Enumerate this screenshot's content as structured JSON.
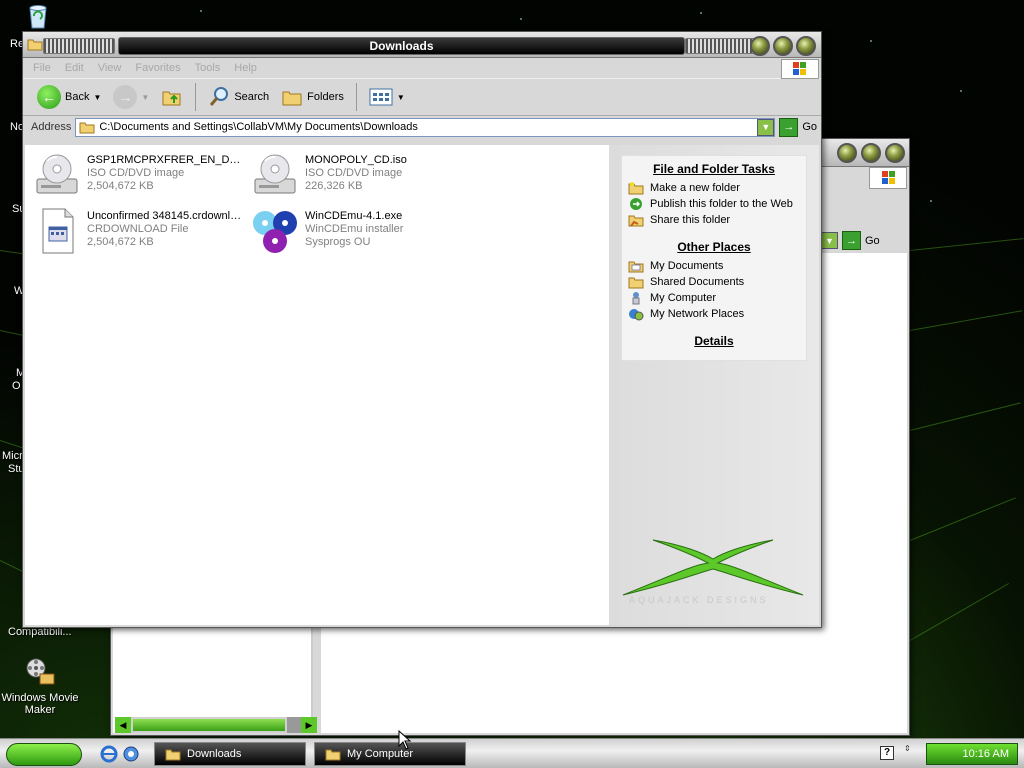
{
  "desktop": {
    "icons": [
      {
        "label": "Windows Movie Maker"
      }
    ],
    "partial_labels": [
      "Re",
      "No",
      "Su",
      "W",
      "M",
      "O",
      "Micro",
      "Stu",
      "Compatibili..."
    ]
  },
  "main_window": {
    "title": "Downloads",
    "menu": [
      "File",
      "Edit",
      "View",
      "Favorites",
      "Tools",
      "Help"
    ],
    "toolbar": {
      "back": "Back",
      "search": "Search",
      "folders": "Folders"
    },
    "address": {
      "label": "Address",
      "value": "C:\\Documents and Settings\\CollabVM\\My Documents\\Downloads",
      "go": "Go"
    },
    "files": [
      {
        "name": "GSP1RMCPRXFRER_EN_DVD.I...",
        "type": "ISO CD/DVD image",
        "size": "2,504,672 KB",
        "icon": "disc-drive-icon"
      },
      {
        "name": "MONOPOLY_CD.iso",
        "type": "ISO CD/DVD image",
        "size": "226,326 KB",
        "icon": "disc-drive-icon"
      },
      {
        "name": "Unconfirmed 348145.crdownload",
        "type": "CRDOWNLOAD File",
        "size": "2,504,672 KB",
        "icon": "generic-file-icon"
      },
      {
        "name": "WinCDEmu-4.1.exe",
        "type": "WinCDEmu installer",
        "size": "Sysprogs OU",
        "icon": "wincdemu-icon"
      }
    ],
    "tasks": {
      "file_folder_heading": "File and Folder Tasks",
      "file_folder_items": [
        "Make a new folder",
        "Publish this folder to the Web",
        "Share this folder"
      ],
      "other_places_heading": "Other Places",
      "other_places_items": [
        "My Documents",
        "Shared Documents",
        "My Computer",
        "My Network Places"
      ],
      "details_heading": "Details"
    },
    "watermark": "AQUAJACK DESIGNS"
  },
  "back_window": {
    "go": "Go"
  },
  "taskbar": {
    "buttons": [
      "Downloads",
      "My Computer"
    ],
    "clock": "10:16 AM"
  },
  "colors": {
    "accent_green": "#5cc82a",
    "title_black": "#000000"
  }
}
